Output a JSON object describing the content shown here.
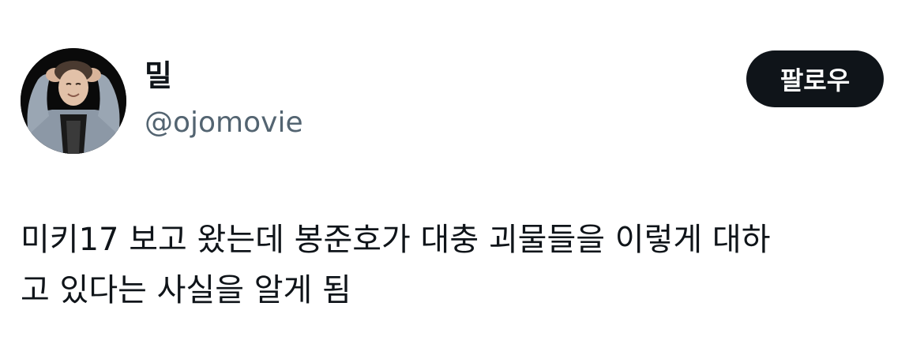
{
  "author": {
    "display_name": "밀",
    "handle": "@ojomovie"
  },
  "actions": {
    "follow_label": "팔로우"
  },
  "tweet": {
    "text": "미키17 보고 왔는데 봉준호가 대충 괴물들을 이렇게 대하\n고 있다는 사실을 알게 됨"
  },
  "colors": {
    "text_primary": "#0f1419",
    "text_secondary": "#536471",
    "button_bg": "#0f1419",
    "button_text": "#ffffff",
    "background": "#ffffff"
  },
  "icons": {
    "avatar": "profile-photo"
  }
}
